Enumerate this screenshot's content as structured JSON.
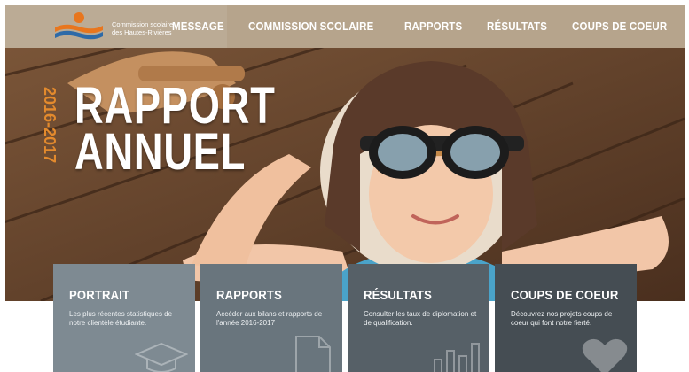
{
  "org": {
    "name_line1": "Commission scolaire",
    "name_line2": "des Hautes-Rivières"
  },
  "nav": {
    "items": [
      "MESSAGE",
      "COMMISSION SCOLAIRE",
      "RAPPORTS",
      "RÉSULTATS",
      "COUPS DE COEUR"
    ]
  },
  "hero": {
    "year": "2016-2017",
    "title_line1": "RAPPORT",
    "title_line2": "ANNUEL"
  },
  "cards": [
    {
      "title": "PORTRAIT",
      "text": "Les plus récentes statistiques de notre clientèle étudiante.",
      "icon": "graduation-cap-icon",
      "color": "#7e8a92"
    },
    {
      "title": "RAPPORTS",
      "text": "Accéder aux bilans et rapports de l'année 2016-2017",
      "icon": "document-icon",
      "color": "#69757d"
    },
    {
      "title": "RÉSULTATS",
      "text": "Consulter les taux de diplomation et de qualification.",
      "icon": "bar-chart-icon",
      "color": "#566067"
    },
    {
      "title": "COUPS DE COEUR",
      "text": "Découvrez nos projets coups de coeur qui font notre fierté.",
      "icon": "heart-icon",
      "color": "#454d53"
    }
  ],
  "colors": {
    "topbar": "#b6a48c",
    "accent_orange": "#e38a2d",
    "logo_blue": "#2d6aa8"
  }
}
